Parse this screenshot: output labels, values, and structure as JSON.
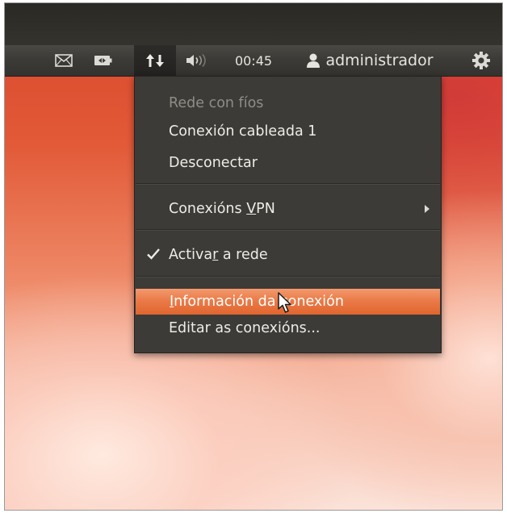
{
  "panel": {
    "clock": "00:45",
    "user": "administrador",
    "indicators": {
      "mail": "envelope-icon",
      "battery": "battery-icon",
      "network": "network-arrows-icon",
      "sound": "speaker-icon",
      "user": "person-icon",
      "session": "gear-icon"
    }
  },
  "menu": {
    "items": [
      {
        "id": "wired-header",
        "label": "Rede con fíos",
        "enabled": false
      },
      {
        "id": "wired-connection",
        "label": "Conexión cableada 1",
        "enabled": true
      },
      {
        "id": "disconnect",
        "label": "Desconectar",
        "enabled": true
      },
      {
        "id": "vpn",
        "label": "Conexións VPN",
        "enabled": true,
        "mnemonic": "V",
        "has_submenu": true
      },
      {
        "id": "enable-network",
        "label": "Activar a rede",
        "enabled": true,
        "mnemonic": "r",
        "checked": true
      },
      {
        "id": "connection-info",
        "label": "Información da conexión",
        "enabled": true,
        "mnemonic": "I",
        "highlighted": true
      },
      {
        "id": "edit-connections",
        "label": "Editar as conexións...",
        "enabled": true
      }
    ]
  },
  "colors": {
    "panel": "#3c3b37",
    "menu_bg": "#3c3b37",
    "highlight": "#e9773f",
    "text": "#eeece6",
    "disabled_text": "#8f8d87",
    "wallpaper": "#e25a38"
  }
}
